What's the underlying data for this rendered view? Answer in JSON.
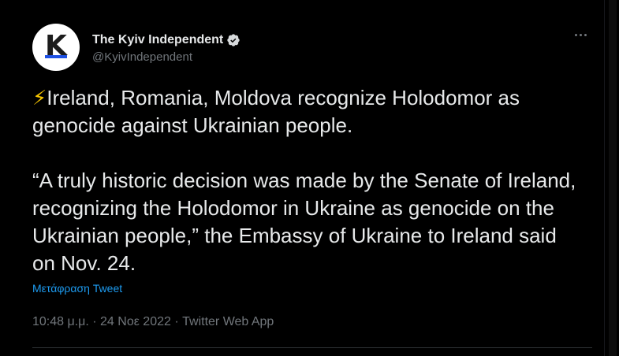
{
  "author": {
    "display_name": "The Kyiv Independent",
    "handle": "@KyivIndependent",
    "avatar_letter": "K",
    "verified": true
  },
  "tweet": {
    "paragraph1_emoji": "⚡",
    "paragraph1_text": "Ireland, Romania, Moldova recognize Holodomor as genocide against Ukrainian people.",
    "paragraph2_text": "“A truly historic decision was made by the Senate of Ireland, recognizing the Holodomor in Ukraine as genocide on the Ukrainian people,” the Embassy of Ukraine to Ireland said on Nov. 24."
  },
  "translate_label": "Μετάφραση Tweet",
  "meta": {
    "time": "10:48 μ.μ.",
    "separator": " · ",
    "date": "24 Νοε 2022",
    "source": "Twitter Web App"
  },
  "colors": {
    "background": "#000000",
    "text": "#e7e9ea",
    "secondary": "#71767b",
    "link": "#1d9bf0",
    "divider": "#2f3336"
  }
}
